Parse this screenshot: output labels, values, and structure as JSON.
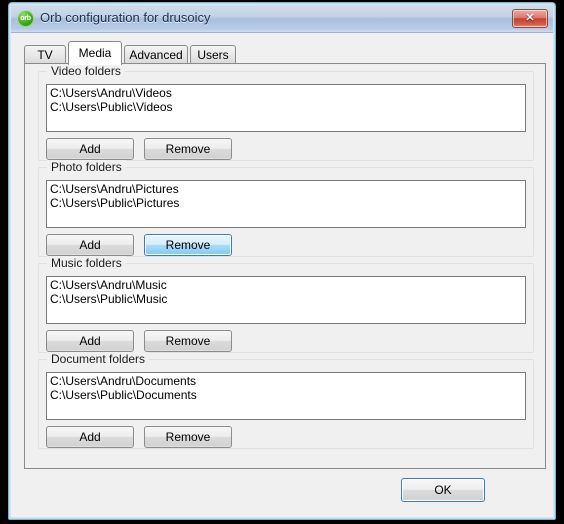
{
  "window": {
    "title": "Orb configuration for drusoicy",
    "icon": "orb-icon",
    "icon_text": "orb",
    "close_label": "✕",
    "accent_blue": "#3c7fb1",
    "frame_color": "#bfdced",
    "dialog_bg": "#f0f0f0"
  },
  "tabs": [
    {
      "label": "TV",
      "selected": false
    },
    {
      "label": "Media",
      "selected": true
    },
    {
      "label": "Advanced",
      "selected": false
    },
    {
      "label": "Users",
      "selected": false
    }
  ],
  "groups": [
    {
      "legend": "Video folders",
      "items": [
        "C:\\Users\\Andru\\Videos",
        "C:\\Users\\Public\\Videos"
      ],
      "add_label": "Add",
      "remove_label": "Remove",
      "remove_highlighted": false
    },
    {
      "legend": "Photo folders",
      "items": [
        "C:\\Users\\Andru\\Pictures",
        "C:\\Users\\Public\\Pictures"
      ],
      "add_label": "Add",
      "remove_label": "Remove",
      "remove_highlighted": true
    },
    {
      "legend": "Music folders",
      "items": [
        "C:\\Users\\Andru\\Music",
        "C:\\Users\\Public\\Music"
      ],
      "add_label": "Add",
      "remove_label": "Remove",
      "remove_highlighted": false
    },
    {
      "legend": "Document folders",
      "items": [
        "C:\\Users\\Andru\\Documents",
        "C:\\Users\\Public\\Documents"
      ],
      "add_label": "Add",
      "remove_label": "Remove",
      "remove_highlighted": false
    }
  ],
  "footer": {
    "ok_label": "OK"
  }
}
